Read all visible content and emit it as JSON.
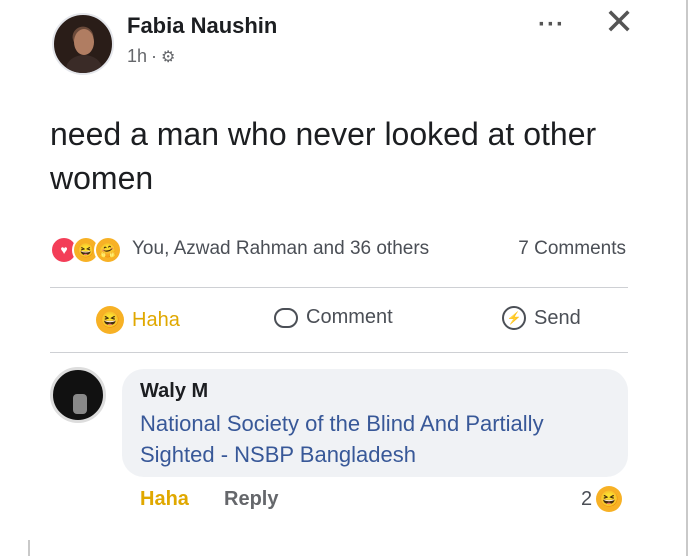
{
  "post": {
    "author": "Fabia Naushin",
    "time": "1h",
    "separator": "·",
    "audience_icon": "gear-icon",
    "text": "need a man who never looked at other women",
    "reactions_text": "You, Azwad Rahman and 36 others",
    "comments_count": "7 Comments"
  },
  "actions": {
    "haha": "Haha",
    "comment": "Comment",
    "send": "Send"
  },
  "comment": {
    "author": "Waly M",
    "text": "National Society of the Blind And Partially Sighted - NSBP Bangladesh",
    "haha_label": "Haha",
    "reply_label": "Reply",
    "reaction_count": "2"
  },
  "colors": {
    "link": "#385898",
    "haha": "#e0a800",
    "bubble": "#f0f2f5"
  }
}
